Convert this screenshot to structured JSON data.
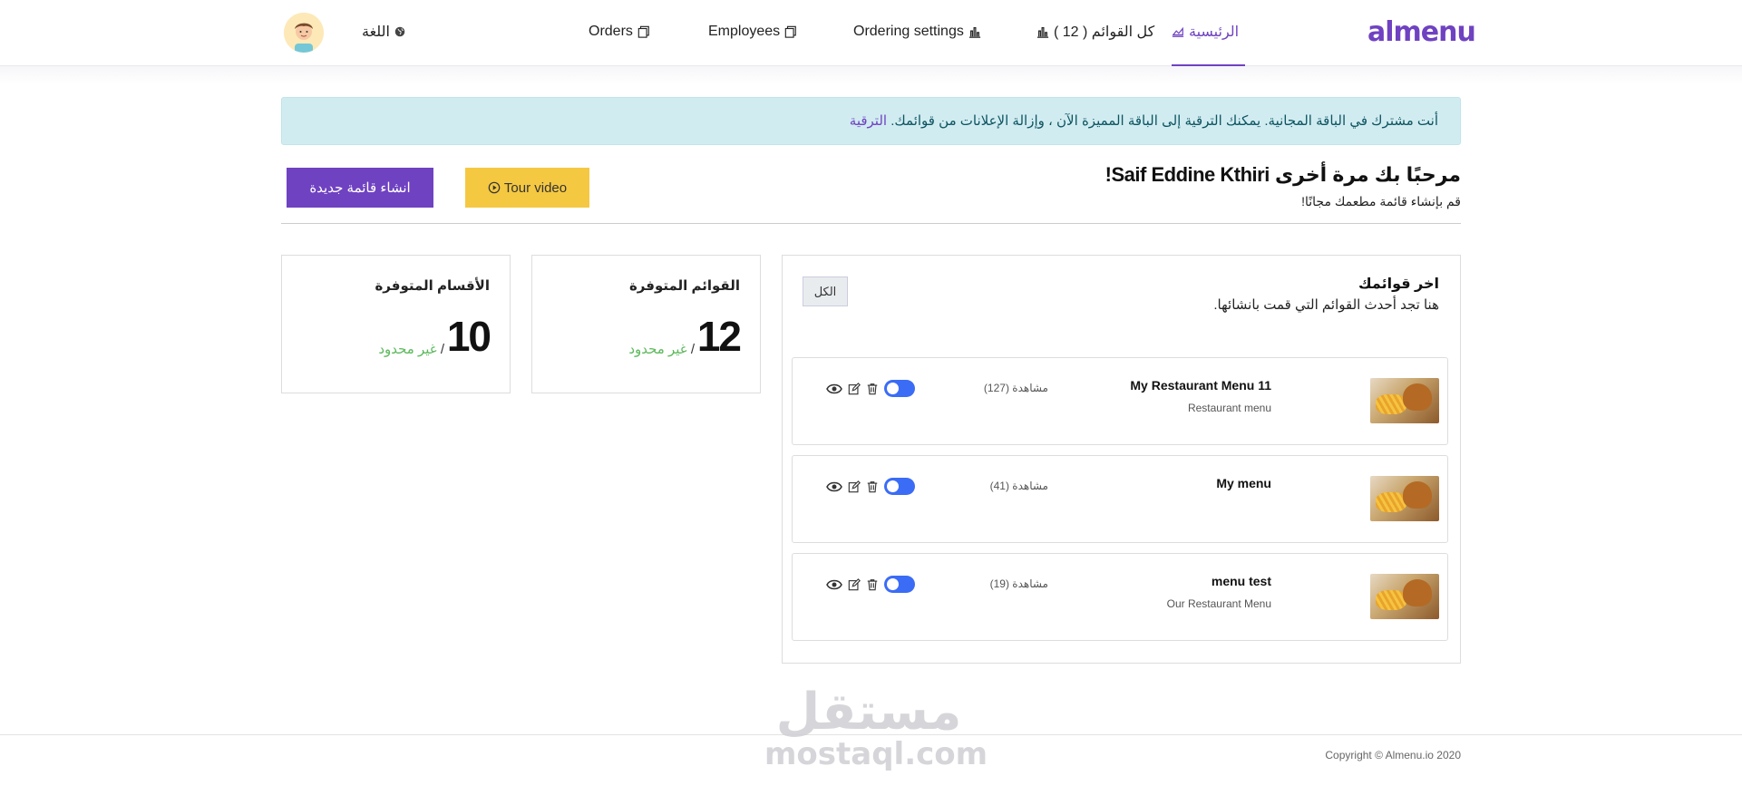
{
  "nav": {
    "logo": "almenu",
    "home": "الرئيسية",
    "all_menus": "كل القوائم ( 12 )",
    "ordering_settings": "Ordering settings",
    "employees": "Employees",
    "orders": "Orders",
    "language": "اللغة"
  },
  "alert": {
    "text": "أنت مشترك في الباقة المجانية. يمكنك الترقية إلى الباقة المميزة الآن ، وإزالة الإعلانات من قوائمك.",
    "link": "الترقية"
  },
  "welcome": {
    "title": "مرحبًا بك مرة أخرى Saif Eddine Kthiri!",
    "subtitle": "قم بإنشاء قائمة مطعمك مجانًا!"
  },
  "buttons": {
    "tour_video": "Tour video",
    "new_menu": "انشاء قائمة جديدة"
  },
  "recent": {
    "title": "اخر قوائمك",
    "subtitle": "هنا تجد أحدث القوائم التي قمت بانشائها.",
    "all_button": "الكل",
    "menus": [
      {
        "name": "My Restaurant Menu 11",
        "description": "Restaurant menu",
        "views": "مشاهدة (127)"
      },
      {
        "name": "My menu",
        "description": "",
        "views": "مشاهدة (41)"
      },
      {
        "name": "menu test",
        "description": "Our Restaurant Menu",
        "views": "مشاهدة (19)"
      }
    ]
  },
  "stats": {
    "menus": {
      "label": "القوائم المتوفرة",
      "value": "12",
      "limit": "غير محدود"
    },
    "sections": {
      "label": "الأقسام المتوفرة",
      "value": "10",
      "limit": "غير محدود"
    }
  },
  "footer": {
    "copyright": "Copyright © Almenu.io 2020",
    "watermark_ar": "مستقل",
    "watermark_en": "mostaql.com"
  },
  "colors": {
    "brand": "#6f42c1",
    "tour": "#f5c842",
    "toggle": "#3b6cf6",
    "unlimited": "#5cb85c"
  }
}
